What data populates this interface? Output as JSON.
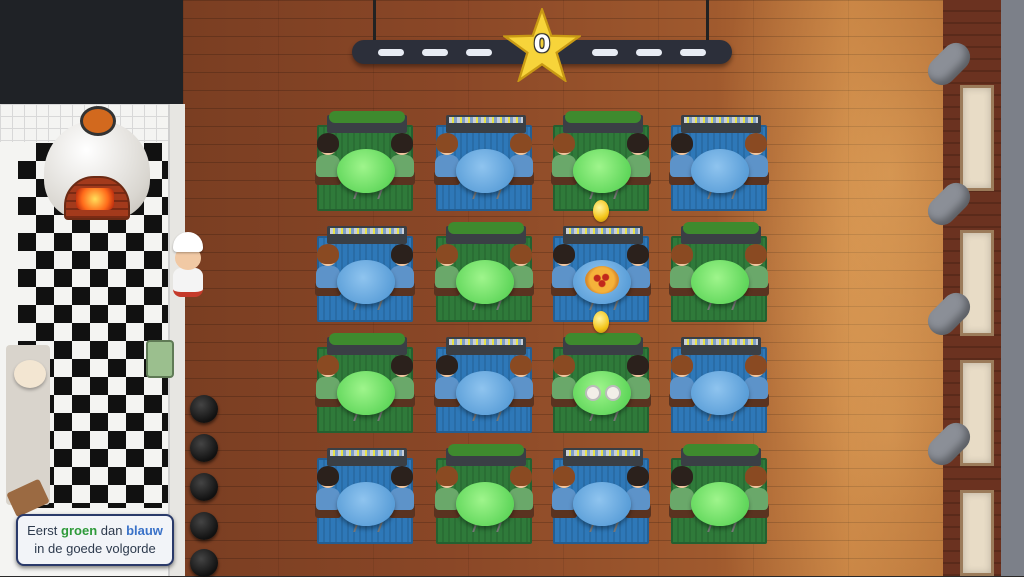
{
  "hud": {
    "score": "0",
    "star_color": "#f7d43a"
  },
  "instruction": {
    "part1": "Eerst ",
    "green_word": "groen",
    "part2": " dan ",
    "blue_word": "blauw",
    "line2": "in de goede volgorde"
  },
  "colors": {
    "green_table": "#5fd65a",
    "blue_table": "#5a9ed8",
    "green_rug": "#2f7a3a",
    "blue_rug": "#2e78b8"
  },
  "tables": [
    {
      "row": 1,
      "col": 1,
      "color": "green",
      "planter": "hedge",
      "item": "none"
    },
    {
      "row": 1,
      "col": 2,
      "color": "blue",
      "planter": "flowers",
      "item": "none"
    },
    {
      "row": 1,
      "col": 3,
      "color": "green",
      "planter": "hedge",
      "item": "none"
    },
    {
      "row": 1,
      "col": 4,
      "color": "blue",
      "planter": "flowers",
      "item": "none"
    },
    {
      "row": 2,
      "col": 1,
      "color": "blue",
      "planter": "flowers",
      "item": "none"
    },
    {
      "row": 2,
      "col": 2,
      "color": "green",
      "planter": "hedge",
      "item": "none"
    },
    {
      "row": 2,
      "col": 3,
      "color": "blue",
      "planter": "flowers",
      "item": "pizza",
      "coin": true
    },
    {
      "row": 2,
      "col": 4,
      "color": "green",
      "planter": "hedge",
      "item": "none"
    },
    {
      "row": 3,
      "col": 1,
      "color": "green",
      "planter": "hedge",
      "item": "none"
    },
    {
      "row": 3,
      "col": 2,
      "color": "blue",
      "planter": "flowers",
      "item": "none"
    },
    {
      "row": 3,
      "col": 3,
      "color": "green",
      "planter": "hedge",
      "item": "cups",
      "coin": true
    },
    {
      "row": 3,
      "col": 4,
      "color": "blue",
      "planter": "flowers",
      "item": "none"
    },
    {
      "row": 4,
      "col": 1,
      "color": "blue",
      "planter": "flowers",
      "item": "none"
    },
    {
      "row": 4,
      "col": 2,
      "color": "green",
      "planter": "hedge",
      "item": "none"
    },
    {
      "row": 4,
      "col": 3,
      "color": "blue",
      "planter": "flowers",
      "item": "none"
    },
    {
      "row": 4,
      "col": 4,
      "color": "green",
      "planter": "hedge",
      "item": "none"
    }
  ]
}
